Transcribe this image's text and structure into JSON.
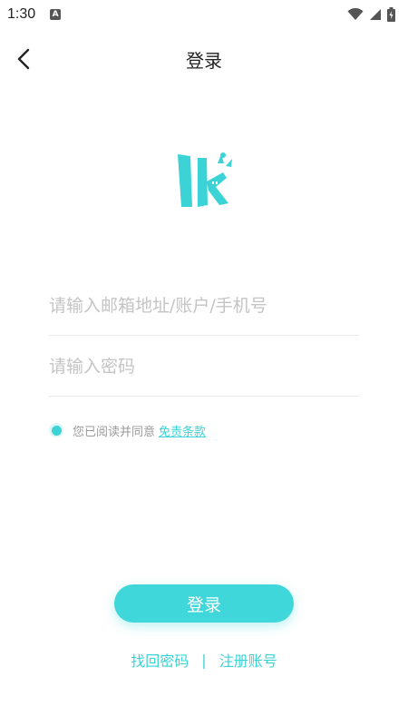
{
  "status_bar": {
    "time": "1:30",
    "notification_letter": "A",
    "icons": [
      "wifi-icon",
      "signal-icon",
      "battery-charging-icon"
    ]
  },
  "header": {
    "title": "登录",
    "back_icon": "chevron-left-icon"
  },
  "logo": {
    "icon": "lk-logo",
    "color": "#3bd3d6"
  },
  "form": {
    "account_placeholder": "请输入邮箱地址/账户/手机号",
    "account_value": "",
    "password_placeholder": "请输入密码",
    "password_value": ""
  },
  "agreement": {
    "checked": true,
    "text": "您已阅读并同意",
    "link_text": "免责条款"
  },
  "actions": {
    "login_label": "登录",
    "forgot_password": "找回密码",
    "separator": "|",
    "register": "注册账号"
  },
  "colors": {
    "accent": "#3bd3d6",
    "placeholder": "#c4c4c4",
    "divider": "#e9e9e9"
  }
}
